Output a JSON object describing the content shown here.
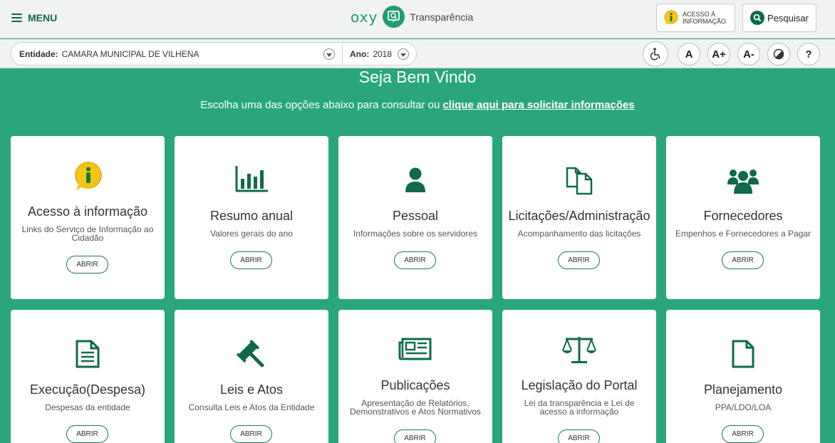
{
  "header": {
    "menu_label": "MENU",
    "brand_name": "oxy",
    "brand_product": "Transparência",
    "acesso_btn_line1": "ACESSO À",
    "acesso_btn_line2": "INFORMAÇÃO",
    "search_btn_label": "Pesquisar"
  },
  "filters": {
    "entidade_label": "Entidade:",
    "entidade_value": "CAMARA MUNICIPAL DE VILHENA",
    "ano_label": "Ano:",
    "ano_value": "2018"
  },
  "accessibility": {
    "font_normal": "A",
    "font_increase": "A+",
    "font_decrease": "A-",
    "help": "?"
  },
  "hero": {
    "title": "Seja Bem Vindo",
    "subtitle": "Escolha uma das opções abaixo para consultar ou",
    "link_text": "clique aqui para solicitar informações"
  },
  "cards": [
    {
      "title": "Acesso à informação",
      "desc": "Links do Serviço de Informação ao Cidadão",
      "button": "ABRIR",
      "icon": "info-icon"
    },
    {
      "title": "Resumo anual",
      "desc": "Valores gerais do ano",
      "button": "ABRIR",
      "icon": "bar-chart-icon"
    },
    {
      "title": "Pessoal",
      "desc": "Informações sobre os servidores",
      "button": "ABRIR",
      "icon": "person-icon"
    },
    {
      "title": "Licitações/Administração",
      "desc": "Acompanhamento das licitações",
      "button": "ABRIR",
      "icon": "copy-documents-icon"
    },
    {
      "title": "Fornecedores",
      "desc": "Empenhos e Fornecedores a Pagar",
      "button": "ABRIR",
      "icon": "users-icon"
    },
    {
      "title": "Execução(Despesa)",
      "desc": "Despesas da entidade",
      "button": "ABRIR",
      "icon": "document-icon"
    },
    {
      "title": "Leis e Atos",
      "desc": "Consulta Leis e Atos da Entidade",
      "button": "ABRIR",
      "icon": "gavel-icon"
    },
    {
      "title": "Publicações",
      "desc": "Apresentação de Relatórios, Demonstrativos e Atos Normativos",
      "button": "ABRIR",
      "icon": "newspaper-icon"
    },
    {
      "title": "Legislação do Portal",
      "desc": "Lei da transparência e Lei de acesso a informação",
      "button": "ABRIR",
      "icon": "scales-icon"
    },
    {
      "title": "Planejamento",
      "desc": "PPA/LDO/LOA",
      "button": "ABRIR",
      "icon": "file-icon"
    }
  ],
  "colors": {
    "primary": "#106a4a",
    "background": "#2aa77a"
  }
}
